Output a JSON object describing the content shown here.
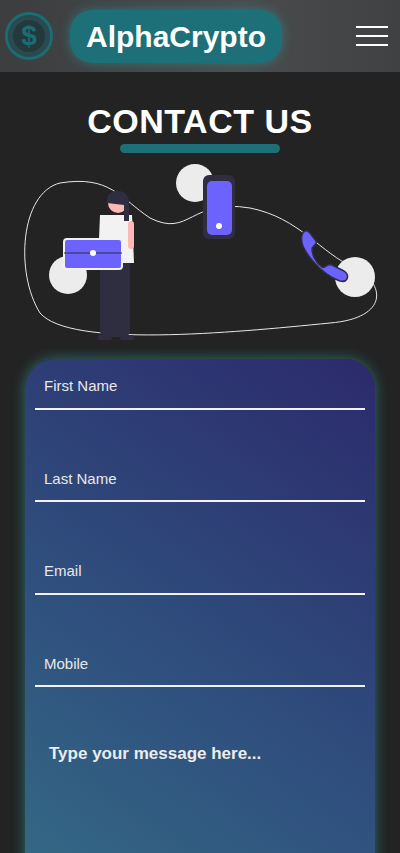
{
  "header": {
    "logo_icon": "$",
    "brand": "AlphaCrypto"
  },
  "heading": "CONTACT US",
  "form": {
    "fields": [
      {
        "label": "First Name",
        "kind": "input"
      },
      {
        "label": "Last Name",
        "kind": "input"
      },
      {
        "label": "Email",
        "kind": "input"
      },
      {
        "label": "Mobile",
        "kind": "input"
      },
      {
        "label": "Type your message here...",
        "kind": "textarea"
      }
    ]
  }
}
